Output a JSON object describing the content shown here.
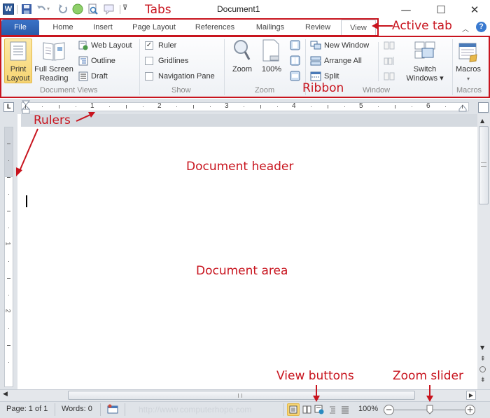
{
  "window": {
    "title": "Document1",
    "app_icon": "W",
    "controls": {
      "minimize": "—",
      "maximize": "☐",
      "close": "✕"
    }
  },
  "quick_access": [
    {
      "name": "save-icon"
    },
    {
      "name": "undo-icon"
    },
    {
      "name": "redo-icon"
    },
    {
      "name": "green-circle-icon"
    },
    {
      "name": "print-preview-icon"
    },
    {
      "name": "comment-icon"
    },
    {
      "name": "customize-qat-icon"
    }
  ],
  "tabs": [
    {
      "label": "File"
    },
    {
      "label": "Home"
    },
    {
      "label": "Insert"
    },
    {
      "label": "Page Layout"
    },
    {
      "label": "References"
    },
    {
      "label": "Mailings"
    },
    {
      "label": "Review"
    },
    {
      "label": "View"
    }
  ],
  "active_tab": "View",
  "ribbon": {
    "document_views": {
      "label": "Document Views",
      "print_layout": "Print Layout",
      "print_layout_l1": "Print",
      "print_layout_l2": "Layout",
      "full_screen_l1": "Full Screen",
      "full_screen_l2": "Reading",
      "web_layout": "Web Layout",
      "outline": "Outline",
      "draft": "Draft"
    },
    "show": {
      "label": "Show",
      "ruler": "Ruler",
      "ruler_checked": true,
      "gridlines": "Gridlines",
      "gridlines_checked": false,
      "navigation_pane": "Navigation Pane",
      "navigation_pane_checked": false
    },
    "zoom": {
      "label": "Zoom",
      "zoom": "Zoom",
      "hundred": "100%"
    },
    "window": {
      "label": "Window",
      "new_window": "New Window",
      "arrange_all": "Arrange All",
      "split": "Split",
      "switch_l1": "Switch",
      "switch_l2": "Windows ▾"
    },
    "macros": {
      "label": "Macros",
      "macros": "Macros",
      "arrow": "▾"
    }
  },
  "ruler": {
    "h_numbers": [
      "1",
      "2",
      "3",
      "4",
      "5",
      "6"
    ],
    "v_numbers": [
      "1",
      "2"
    ]
  },
  "status": {
    "page": "Page: 1 of 1",
    "words": "Words: 0",
    "watermark": "http://www.computerhope.com",
    "zoom_level": "100%",
    "zoom_value_percent": 100
  },
  "annotations": {
    "tabs": "Tabs",
    "active_tab": "Active tab",
    "ribbon": "Ribbon",
    "rulers": "Rulers",
    "document_header": "Document header",
    "document_area": "Document area",
    "view_buttons": "View buttons",
    "zoom_slider": "Zoom slider"
  },
  "colors": {
    "annotation": "#c8141e",
    "file_tab": "#2a5aa8",
    "active_view_button": "#f6d472"
  }
}
